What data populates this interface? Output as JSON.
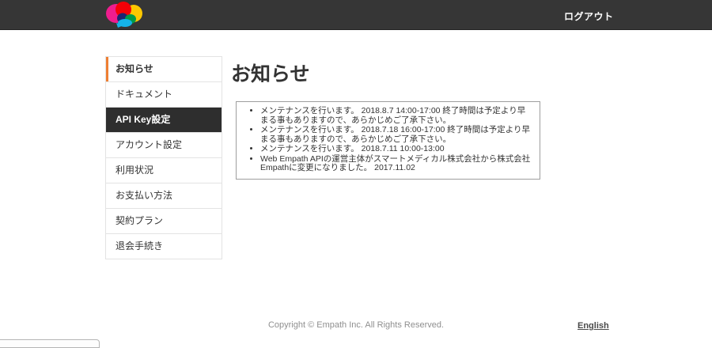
{
  "header": {
    "logout_label": "ログアウト",
    "logo_icon": "empath-brain-logo"
  },
  "sidebar": {
    "items": [
      {
        "label": "お知らせ",
        "state": "active"
      },
      {
        "label": "ドキュメント",
        "state": "normal"
      },
      {
        "label": "API Key設定",
        "state": "highlighted"
      },
      {
        "label": "アカウント設定",
        "state": "normal"
      },
      {
        "label": "利用状況",
        "state": "normal"
      },
      {
        "label": "お支払い方法",
        "state": "normal"
      },
      {
        "label": "契約プラン",
        "state": "normal"
      },
      {
        "label": "退会手続き",
        "state": "normal"
      }
    ]
  },
  "main": {
    "title": "お知らせ",
    "notices": [
      "メンテナンスを行います。 2018.8.7 14:00-17:00 終了時間は予定より早まる事もありますので、あらかじめご了承下さい。",
      "メンテナンスを行います。 2018.7.18 16:00-17:00 終了時間は予定より早まる事もありますので、あらかじめご了承下さい。",
      "メンテナンスを行います。 2018.7.11 10:00-13:00",
      "Web Empath APIの運営主体がスマートメディカル株式会社から株式会社Empathに変更になりました。 2017.11.02"
    ]
  },
  "footer": {
    "copyright": "Copyright © Empath Inc. All Rights Reserved.",
    "language_link": "English"
  },
  "colors": {
    "header_bg": "#363636",
    "accent_orange": "#ee7f33",
    "highlighted_item_bg": "#2e2e2e",
    "logo_magenta": "#ee1d8e",
    "logo_red": "#f50007",
    "logo_yellow": "#fdc800",
    "logo_navy": "#1d2472",
    "logo_green": "#009b49",
    "logo_cyan": "#15b4e9"
  }
}
